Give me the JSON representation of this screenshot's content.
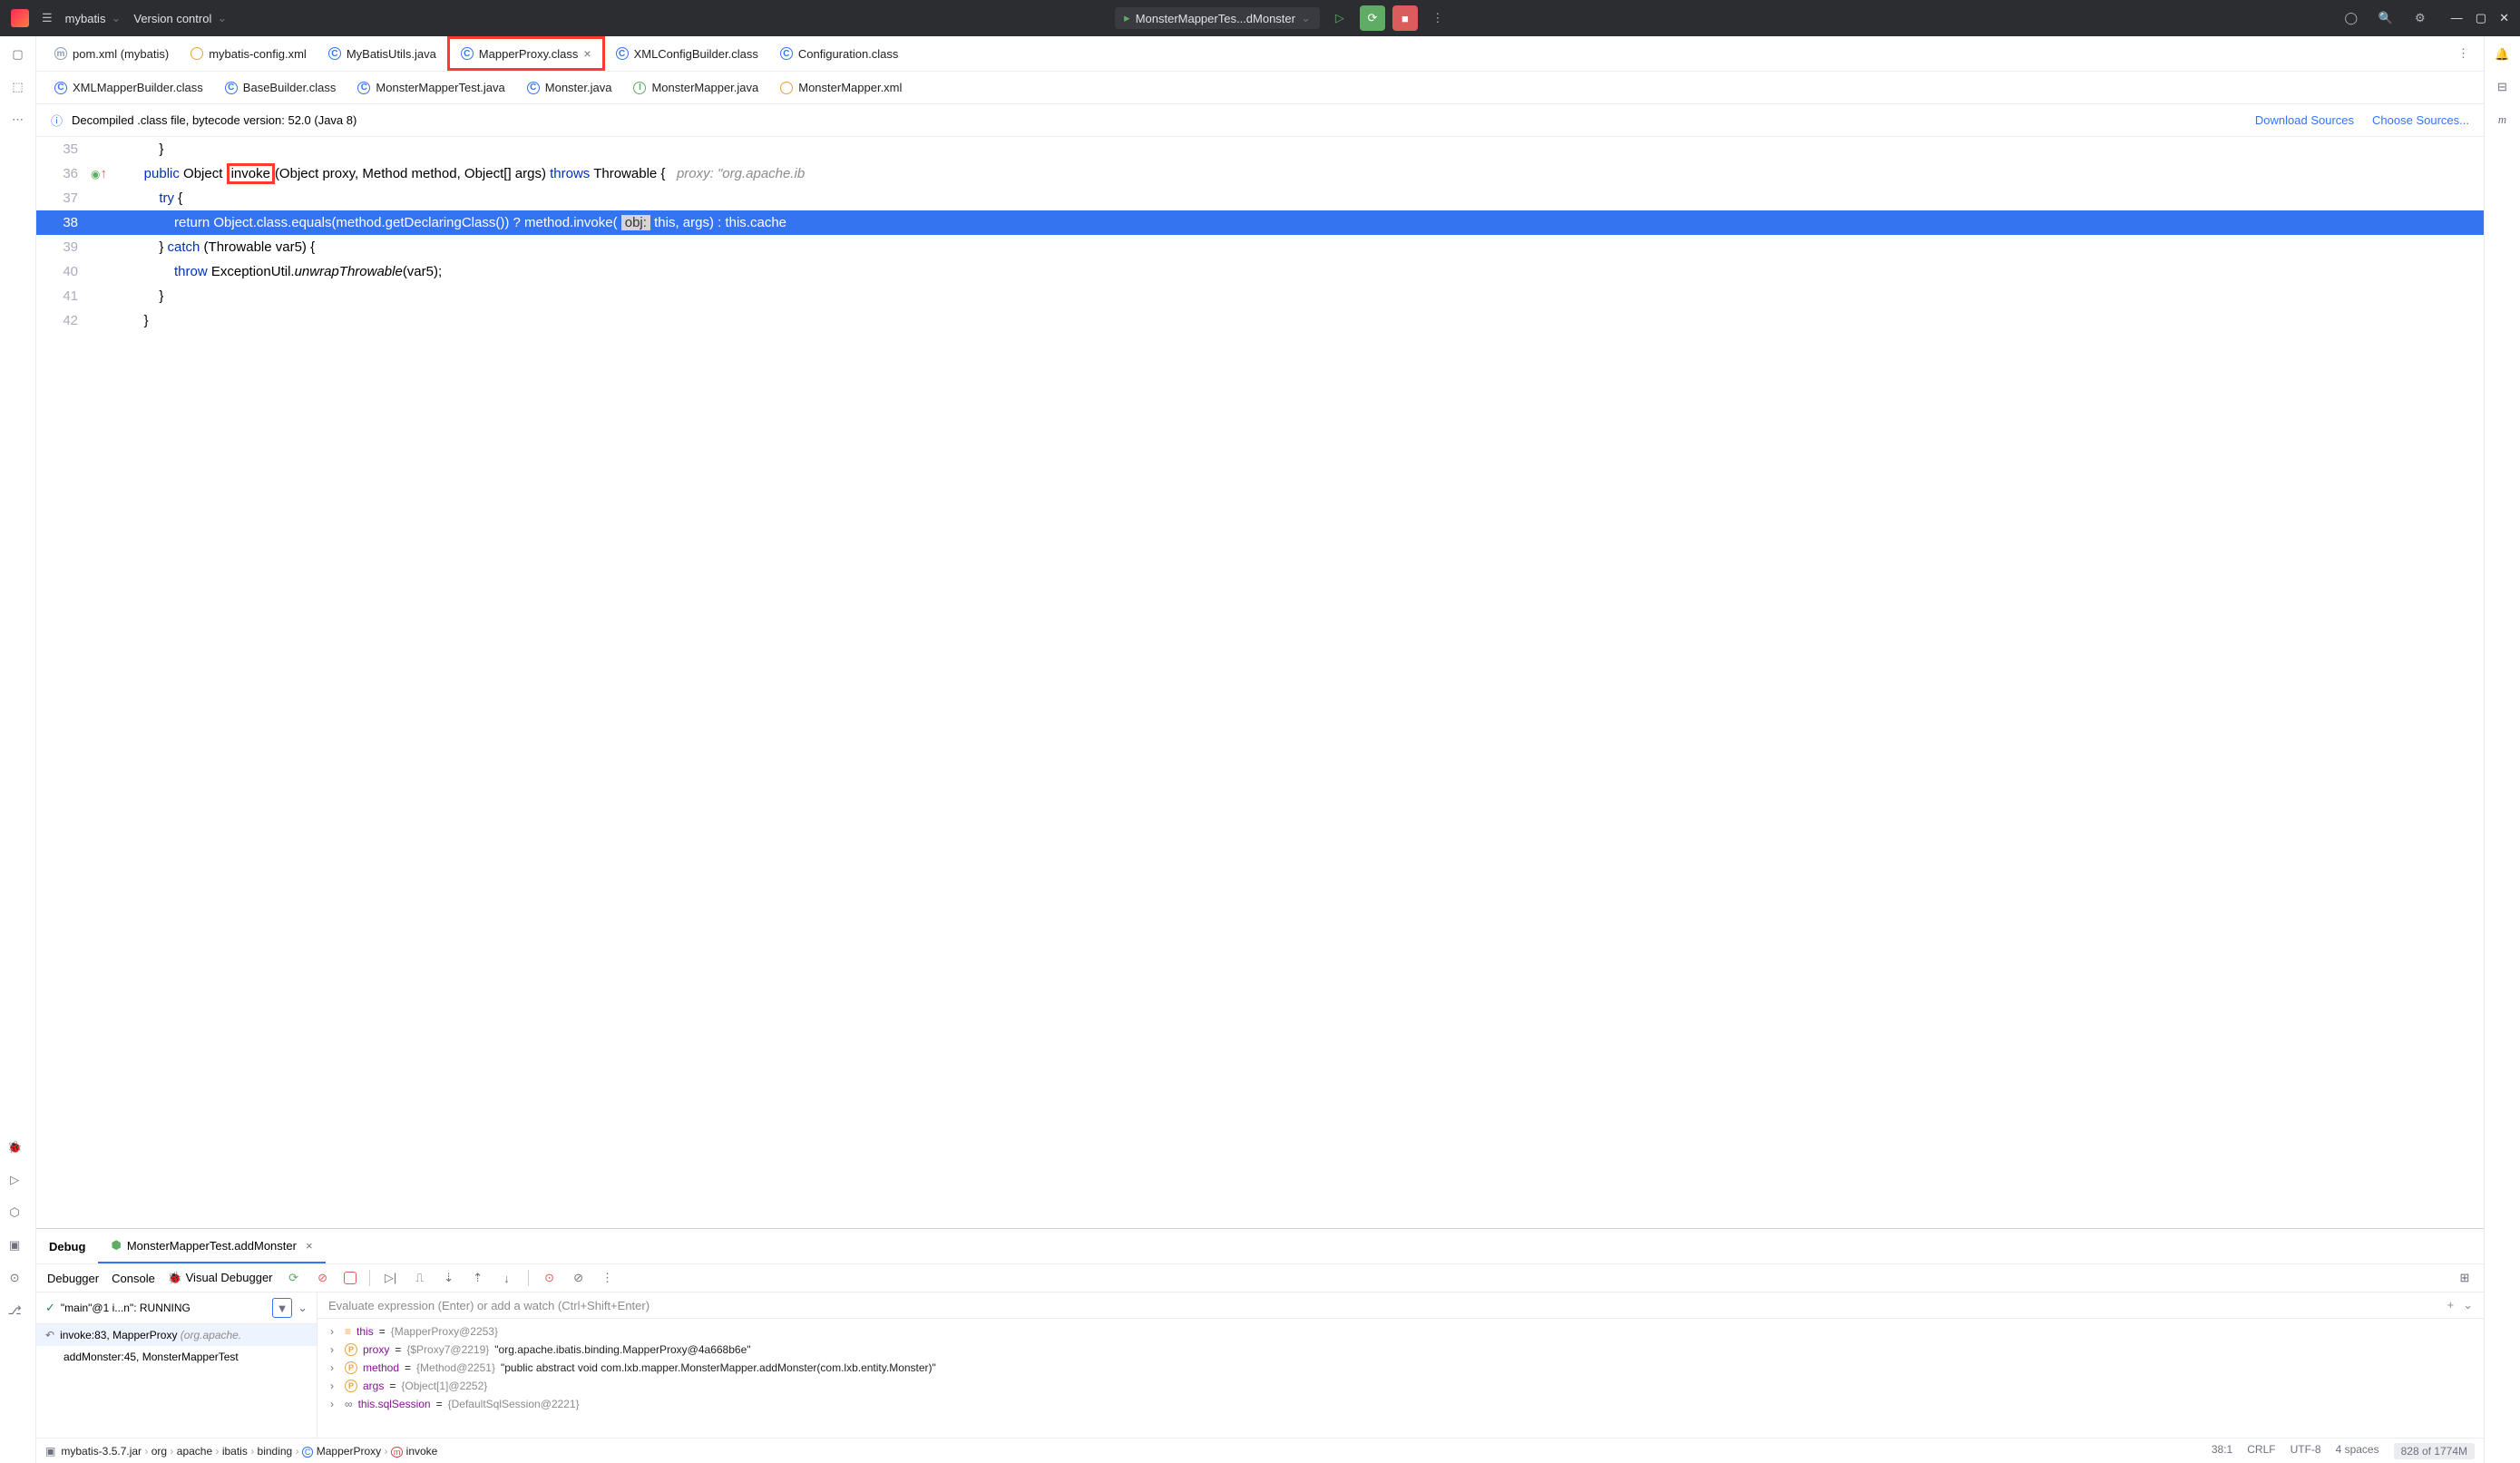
{
  "titlebar": {
    "project": "mybatis",
    "vcs": "Version control",
    "run_config": "MonsterMapperTes...dMonster"
  },
  "file_tabs_row1": [
    {
      "icon": "m",
      "label": "pom.xml (mybatis)",
      "color": "#8c9aaf"
    },
    {
      "icon": "</>",
      "label": "mybatis-config.xml",
      "color": "#e8a33d"
    },
    {
      "icon": "C",
      "label": "MyBatisUtils.java",
      "color": "#3574f0"
    },
    {
      "icon": "C",
      "label": "MapperProxy.class",
      "color": "#3574f0",
      "active": true,
      "highlighted": true
    },
    {
      "icon": "C",
      "label": "XMLConfigBuilder.class",
      "color": "#3574f0"
    },
    {
      "icon": "C",
      "label": "Configuration.class",
      "color": "#3574f0"
    }
  ],
  "file_tabs_row2": [
    {
      "icon": "C",
      "label": "XMLMapperBuilder.class",
      "color": "#3574f0"
    },
    {
      "icon": "C",
      "label": "BaseBuilder.class",
      "color": "#3574f0"
    },
    {
      "icon": "C",
      "label": "MonsterMapperTest.java",
      "color": "#3574f0"
    },
    {
      "icon": "C",
      "label": "Monster.java",
      "color": "#3574f0"
    },
    {
      "icon": "I",
      "label": "MonsterMapper.java",
      "color": "#5fad65"
    },
    {
      "icon": "</>",
      "label": "MonsterMapper.xml",
      "color": "#e8a33d"
    }
  ],
  "notice": {
    "text": "Decompiled .class file, bytecode version: 52.0 (Java 8)",
    "link1": "Download Sources",
    "link2": "Choose Sources..."
  },
  "code": {
    "lines": [
      {
        "num": "35",
        "text": ""
      },
      {
        "num": "36",
        "mark": "override"
      },
      {
        "num": "37",
        "text": "        try {"
      },
      {
        "num": "38",
        "selected": true
      },
      {
        "num": "39",
        "text": "        } catch (Throwable var5) {"
      },
      {
        "num": "40",
        "text": "            throw ExceptionUtil.unwrapThrowable(var5);"
      },
      {
        "num": "41",
        "text": "        }"
      },
      {
        "num": "42",
        "text": "    }"
      }
    ],
    "line36": {
      "public": "public",
      "object": "Object",
      "invoke": "invoke",
      "params": "(Object proxy, Method method, Object[] args)",
      "throws": "throws",
      "throwable": "Throwable {",
      "hint": "proxy: \"org.apache.ib"
    },
    "line38": {
      "return": "return",
      "expr1": "Object.class.equals(method.getDeclaringClass()) ? method.invoke(",
      "obj": "obj:",
      "expr2": "this, args) : this.cache"
    },
    "line37_kw": "try",
    "line39_kw": "catch",
    "line40_kw": "throw",
    "line40_method": "unwrapThrowable"
  },
  "debug": {
    "panel_label": "Debug",
    "session": "MonsterMapperTest.addMonster",
    "subtabs": {
      "debugger": "Debugger",
      "console": "Console",
      "visual": "Visual Debugger"
    },
    "thread": "\"main\"@1 i...n\": RUNNING",
    "eval_placeholder": "Evaluate expression (Enter) or add a watch (Ctrl+Shift+Enter)",
    "frames": [
      {
        "label": "invoke:83, MapperProxy",
        "suffix": "(org.apache.",
        "active": true
      },
      {
        "label": "addMonster:45, MonsterMapperTest",
        "suffix": ""
      }
    ],
    "vars": [
      {
        "icon": "f",
        "name": "this",
        "ref": "{MapperProxy@2253}",
        "str": ""
      },
      {
        "icon": "p",
        "name": "proxy",
        "ref": "{$Proxy7@2219}",
        "str": "\"org.apache.ibatis.binding.MapperProxy@4a668b6e\""
      },
      {
        "icon": "p",
        "name": "method",
        "ref": "{Method@2251}",
        "str": "\"public abstract void com.lxb.mapper.MonsterMapper.addMonster(com.lxb.entity.Monster)\""
      },
      {
        "icon": "p",
        "name": "args",
        "ref": "{Object[1]@2252}",
        "str": ""
      },
      {
        "icon": "oo",
        "name": "this.sqlSession",
        "ref": "{DefaultSqlSession@2221}",
        "str": ""
      }
    ]
  },
  "breadcrumb": {
    "items": [
      "mybatis-3.5.7.jar",
      "org",
      "apache",
      "ibatis",
      "binding",
      "MapperProxy",
      "invoke"
    ]
  },
  "statusbar": {
    "pos": "38:1",
    "eol": "CRLF",
    "enc": "UTF-8",
    "indent": "4 spaces",
    "mem": "828 of 1774M"
  }
}
